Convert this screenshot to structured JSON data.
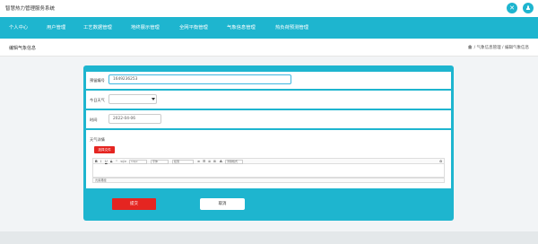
{
  "app": {
    "title": "智慧热力管理服务系统"
  },
  "top_icons": [
    {
      "name": "settings-icon"
    },
    {
      "name": "user-icon"
    }
  ],
  "nav": {
    "items": [
      "个人中心",
      "用户管理",
      "工艺数据管理",
      "地终展示管理",
      "全网平衡管理",
      "气象信息管理",
      "热负荷预测管理"
    ]
  },
  "page": {
    "title": "编辑气象信息",
    "breadcrumb": "/ 气象信息管理 / 编辑气象信息"
  },
  "form": {
    "number_label": "预留编号",
    "number_value": "1649236253",
    "weather_label": "今日天气",
    "weather_value": "",
    "time_label": "时间",
    "time_value": "2022-04-06",
    "detail_label": "天气详情",
    "upload_label": "选择文件",
    "editor": {
      "tools": [
        "B",
        "I",
        "U",
        "S",
        "\"",
        "</>"
      ],
      "font_size": "14px",
      "font_family": "字体",
      "paragraph": "段落",
      "align_label": "默认对齐",
      "list_tools": [
        "≡",
        "☰",
        "≣",
        "⊞"
      ],
      "color_tool": "A",
      "clear_label": "清除格式",
      "extra_tool": "⚙",
      "status": "元素路径"
    },
    "submit_label": "提交",
    "cancel_label": "取消"
  },
  "colors": {
    "accent": "#1eb5cf",
    "danger": "#e52521"
  }
}
